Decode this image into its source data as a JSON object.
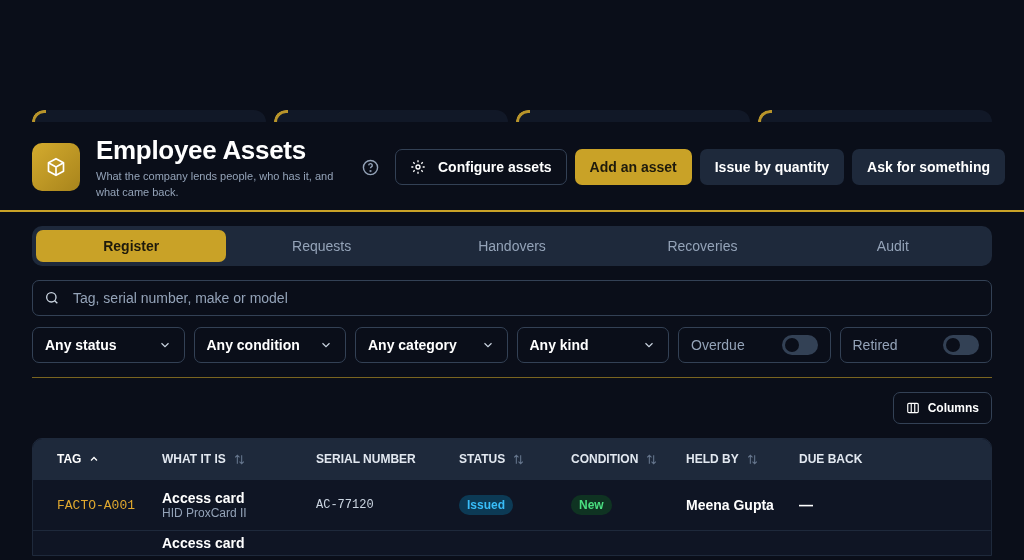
{
  "header": {
    "title": "Employee Assets",
    "subtitle": "What the company lends people, who has it, and what came back.",
    "actions": [
      {
        "label": "Configure assets",
        "kind": "outline"
      },
      {
        "label": "Add an asset",
        "kind": "primary"
      },
      {
        "label": "Issue by quantity",
        "kind": "secondary"
      },
      {
        "label": "Ask for something",
        "kind": "secondary"
      }
    ]
  },
  "tabs": [
    {
      "label": "Register",
      "selected": true
    },
    {
      "label": "Requests",
      "selected": false
    },
    {
      "label": "Handovers",
      "selected": false
    },
    {
      "label": "Recoveries",
      "selected": false
    },
    {
      "label": "Audit",
      "selected": false
    }
  ],
  "search": {
    "placeholder": "Tag, serial number, make or model"
  },
  "filters": [
    {
      "kind": "select",
      "label": "Any status"
    },
    {
      "kind": "select",
      "label": "Any condition"
    },
    {
      "kind": "select",
      "label": "Any category"
    },
    {
      "kind": "select",
      "label": "Any kind"
    },
    {
      "kind": "toggle",
      "label": "Overdue",
      "on": false
    },
    {
      "kind": "toggle",
      "label": "Retired",
      "on": false
    }
  ],
  "columns_button": "Columns",
  "table": {
    "columns": [
      {
        "label": "TAG",
        "sortable": true,
        "sorted": true
      },
      {
        "label": "WHAT IT IS",
        "sortable": true,
        "sorted": false
      },
      {
        "label": "SERIAL NUMBER",
        "sortable": false,
        "sorted": false
      },
      {
        "label": "STATUS",
        "sortable": true,
        "sorted": false
      },
      {
        "label": "CONDITION",
        "sortable": true,
        "sorted": false
      },
      {
        "label": "HELD BY",
        "sortable": true,
        "sorted": false
      },
      {
        "label": "DUE BACK",
        "sortable": false,
        "sorted": false
      }
    ],
    "rows": [
      {
        "tag": "FACTO-A001",
        "name": "Access card",
        "model": "HID ProxCard II",
        "serial": "AC-77120",
        "status": "Issued",
        "condition": "New",
        "held_by": "Meena Gupta",
        "due_back": "—"
      },
      {
        "name": "Access card"
      }
    ]
  }
}
